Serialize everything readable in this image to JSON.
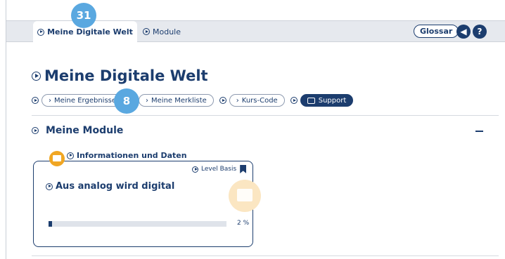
{
  "tabs": [
    {
      "label": "Meine Digitale Welt",
      "active": true
    },
    {
      "label": "Module",
      "active": false
    }
  ],
  "header": {
    "glossar_label": "Glossar",
    "icons": [
      "sound-muted-icon",
      "help-icon"
    ]
  },
  "annotations": {
    "tab_badge": "31",
    "nav_badge": "8"
  },
  "page": {
    "title": "Meine Digitale Welt"
  },
  "nav": [
    {
      "label": "Meine Ergebnisse"
    },
    {
      "label": "Meine Merkliste"
    },
    {
      "label": "Kurs-Code"
    },
    {
      "label": "Support"
    }
  ],
  "section": {
    "title": "Meine Module"
  },
  "card": {
    "category": "Informationen und Daten",
    "level": "Level Basis",
    "title": "Aus analog wird digital",
    "progress_percent": 2,
    "progress_text": "2 %"
  },
  "colors": {
    "primary": "#1c3d6e",
    "accent_badge": "#5aa8e0",
    "folder": "#f0a623"
  }
}
